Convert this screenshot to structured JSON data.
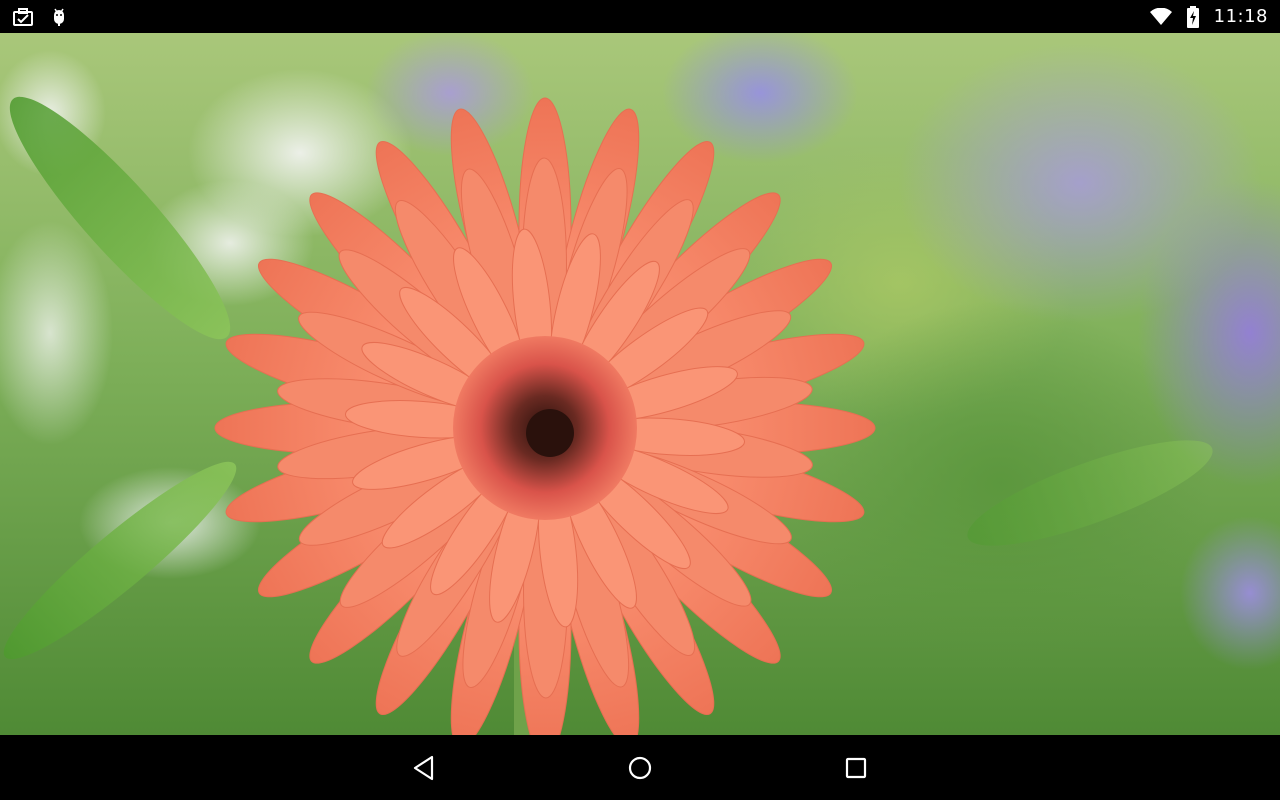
{
  "status_bar": {
    "time": "11:18",
    "left_icons": [
      "briefcase-check-icon",
      "android-debug-icon"
    ],
    "right_icons": [
      "wifi-icon",
      "battery-charging-icon"
    ]
  },
  "photo": {
    "subject": "orange-gerbera-daisy",
    "colors": {
      "petal": "#f58a6b",
      "petal_shadow": "#e66f52",
      "center_ring": "#e35a4a",
      "center_core": "#3a1a14",
      "stem": "#6fa24a"
    }
  },
  "nav_bar": {
    "buttons": [
      "back-icon",
      "home-icon",
      "recents-icon"
    ]
  }
}
